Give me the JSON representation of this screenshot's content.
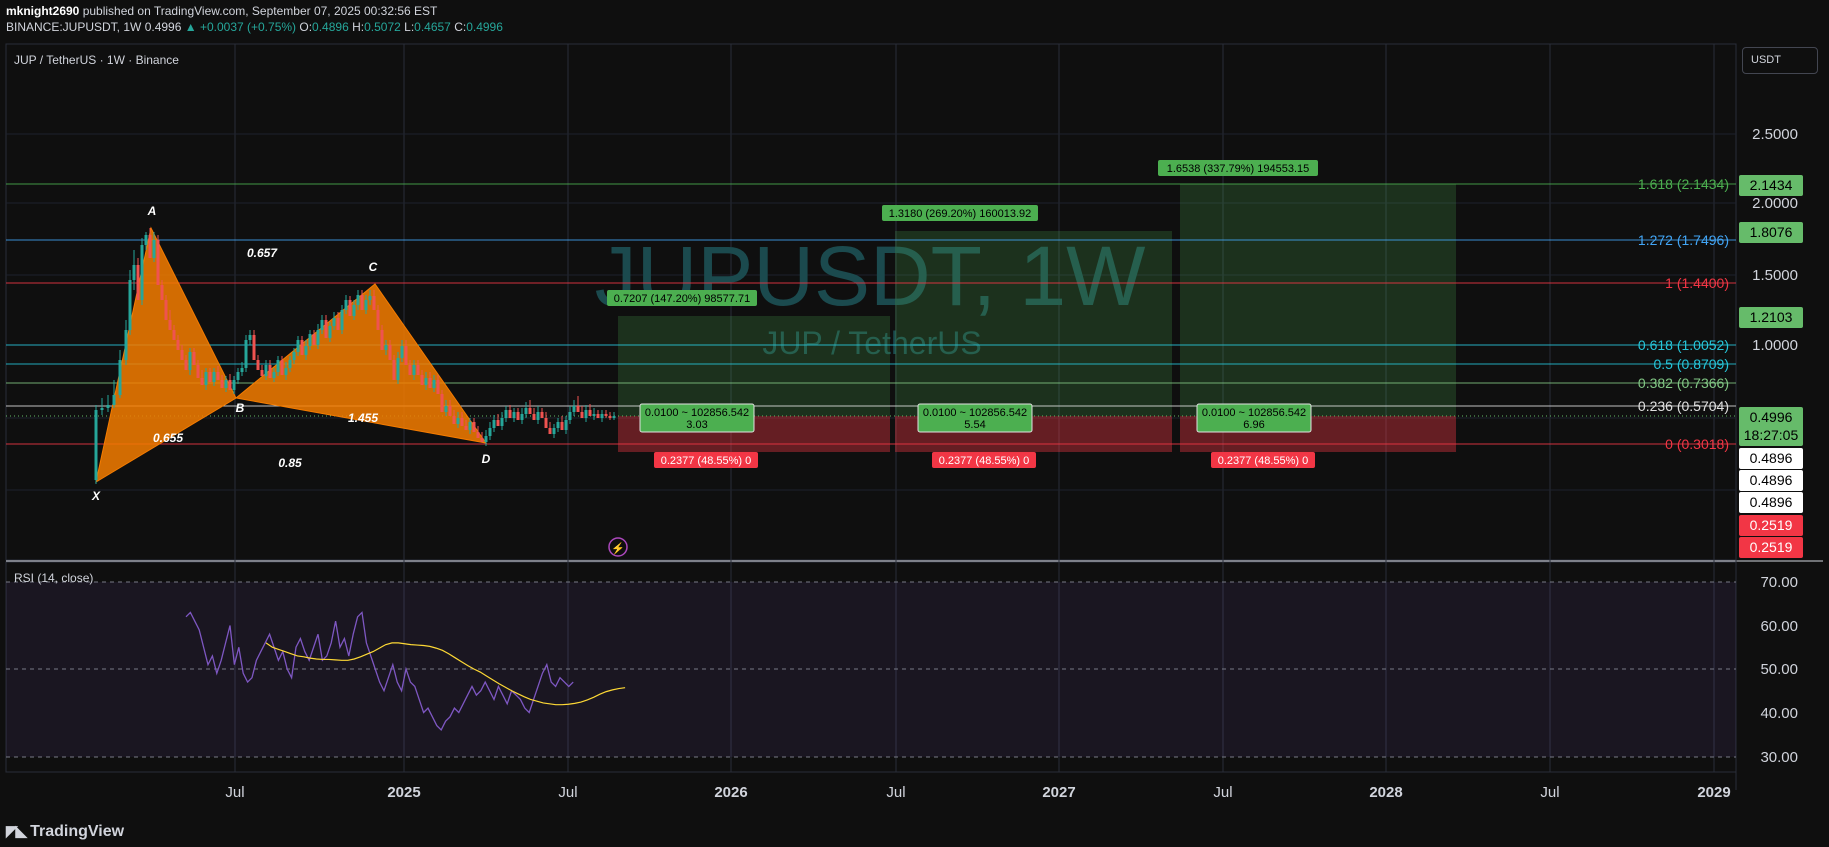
{
  "header": {
    "author": "mknight2690",
    "published_text": "published on TradingView.com, September 07, 2025 00:32:56 EST",
    "symbol_line": "BINANCE:JUPUSDT, 1W",
    "last": "0.4996",
    "change": "▲ +0.0037 (+0.75%)",
    "o_label": "O:",
    "o_val": "0.4896",
    "h_label": "H:",
    "h_val": "0.5072",
    "l_label": "L:",
    "l_val": "0.4657",
    "c_label": "C:",
    "c_val": "0.4996"
  },
  "chart": {
    "legend_title": "JUP / TetherUS · 1W · Binance",
    "watermark_symbol": "JUPUSDT, 1W",
    "watermark_name": "JUP / TetherUS",
    "currency_button": "USDT",
    "price_axis_labels": [
      "2.5000",
      "2.0000",
      "1.5000",
      "1.0000"
    ],
    "fib_levels": [
      {
        "label": "1.618 (2.1434)",
        "color": "#4caf50"
      },
      {
        "label": "1.272 (1.7496)",
        "color": "#42a5f5"
      },
      {
        "label": "1 (1.4400)",
        "color": "#f23645"
      },
      {
        "label": "0.618 (1.0052)",
        "color": "#26c6da"
      },
      {
        "label": "0.5 (0.8709)",
        "color": "#26c6da"
      },
      {
        "label": "0.382 (0.7366)",
        "color": "#81c784"
      },
      {
        "label": "0.236 (0.5704)",
        "color": "#e0e0e0"
      },
      {
        "label": "0 (0.3018)",
        "color": "#f23645"
      }
    ],
    "axis_badges": [
      {
        "text": "2.1434",
        "bg": "#66bb6a",
        "fg": "#000000"
      },
      {
        "text": "1.8076",
        "bg": "#66bb6a",
        "fg": "#000000"
      },
      {
        "text": "1.2103",
        "bg": "#66bb6a",
        "fg": "#000000"
      },
      {
        "text": "0.4996",
        "bg": "#66bb6a",
        "fg": "#000000"
      },
      {
        "text": "18:27:05",
        "bg": "#66bb6a",
        "fg": "#000000"
      },
      {
        "text": "0.4896",
        "bg": "#ffffff",
        "fg": "#000000"
      },
      {
        "text": "0.4896",
        "bg": "#ffffff",
        "fg": "#000000"
      },
      {
        "text": "0.4896",
        "bg": "#ffffff",
        "fg": "#000000"
      },
      {
        "text": "0.2519",
        "bg": "#f23645",
        "fg": "#ffffff"
      },
      {
        "text": "0.2519",
        "bg": "#f23645",
        "fg": "#ffffff"
      }
    ],
    "harmonic_points": [
      "X",
      "A",
      "B",
      "C",
      "D"
    ],
    "harmonic_ratios": [
      "0.657",
      "0.655",
      "1.455",
      "0.85"
    ],
    "positions": [
      {
        "target": "0.7207 (147.20%) 98577.71",
        "entry1": "0.0100 ~ 102856.542",
        "entry2": "3.03",
        "stop": "0.2377 (48.55%) 0"
      },
      {
        "target": "1.3180 (269.20%) 160013.92",
        "entry1": "0.0100 ~ 102856.542",
        "entry2": "5.54",
        "stop": "0.2377 (48.55%) 0"
      },
      {
        "target": "1.6538 (337.79%) 194553.15",
        "entry1": "0.0100 ~ 102856.542",
        "entry2": "6.96",
        "stop": "0.2377 (48.55%) 0"
      }
    ],
    "time_labels": [
      "Jul",
      "2025",
      "Jul",
      "2026",
      "Jul",
      "2027",
      "Jul",
      "2028",
      "Jul",
      "2029"
    ]
  },
  "rsi": {
    "legend": "RSI (14, close)",
    "axis_labels": [
      "70.00",
      "60.00",
      "50.00",
      "40.00",
      "30.00"
    ],
    "rsi_values": [
      62,
      63,
      61,
      59,
      55,
      51,
      53,
      49,
      52,
      56,
      60,
      51,
      55,
      49,
      47,
      48,
      52,
      54,
      56,
      58,
      55,
      52,
      54,
      50,
      48,
      55,
      57,
      54,
      52,
      55,
      58,
      52,
      53,
      56,
      61,
      55,
      57,
      53,
      58,
      62,
      63,
      56,
      53,
      50,
      47,
      45,
      48,
      51,
      47,
      45,
      50,
      47,
      46,
      43,
      40,
      41,
      39,
      37,
      36,
      38,
      39,
      41,
      40,
      42,
      44,
      46,
      44,
      45,
      47,
      45,
      43,
      46,
      44,
      42,
      45,
      44,
      43,
      41,
      40,
      43,
      46,
      49,
      51,
      47,
      46,
      48,
      47,
      46,
      47
    ],
    "ma_values": [
      56,
      55,
      54.5,
      54,
      53.5,
      53,
      52.8,
      52.5,
      52.3,
      52.2,
      52.2,
      52.1,
      52,
      52,
      52.3,
      52.8,
      53.4,
      54,
      54.8,
      55.6,
      56,
      56,
      55.8,
      55.6,
      55.5,
      55.4,
      55.2,
      54.8,
      54.3,
      53.5,
      52.6,
      51.7,
      50.8,
      50,
      49.3,
      48.4,
      47.5,
      46.6,
      45.8,
      45,
      44.3,
      43.6,
      43,
      42.6,
      42.2,
      42,
      41.8,
      41.8,
      41.9,
      42.1,
      42.4,
      42.9,
      43.5,
      44.2,
      44.8,
      45.2,
      45.5,
      45.7
    ]
  },
  "footer": {
    "logo_text": "TradingView"
  }
}
